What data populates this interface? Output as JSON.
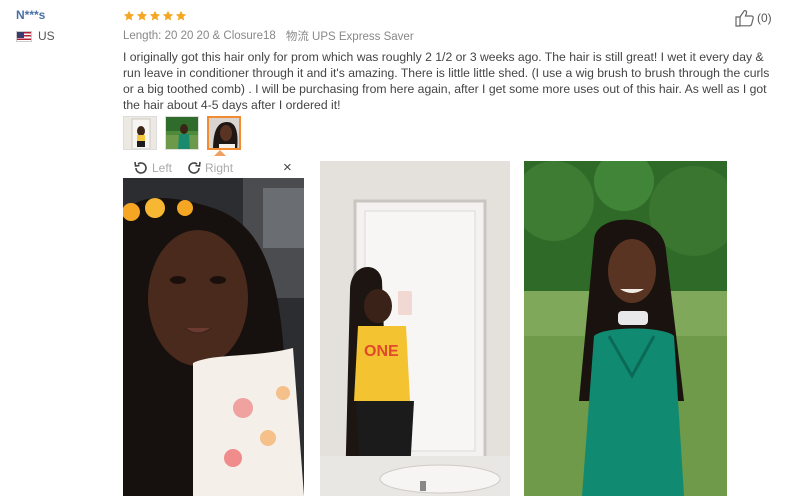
{
  "reviewer": {
    "name": "N***s",
    "country": "US"
  },
  "review": {
    "rating": 5,
    "star_color": "#f5a623",
    "length_label": "Length:",
    "length_value": "20 20 20 & Closure18",
    "shipping_label": "物流",
    "shipping_value": "UPS Express Saver",
    "text": "I originally got this hair only for prom which was roughly 2 1/2 or 3 weeks ago. The hair is still great! I wet it every day & run leave in conditioner through it and it's amazing. There is little little shed. (I use a wig brush to brush through the curls or a big toothed comb) . I will be purchasing from here again, after I get some more uses out of this hair. As well as I got the hair about 4-5 days after I ordered it!"
  },
  "helpful": {
    "icon": "thumbs-up-icon",
    "count": "(0)"
  },
  "viewer": {
    "rotate_left_label": "Left",
    "rotate_right_label": "Right",
    "close_label": "×",
    "active_thumb_color": "#f38b30"
  }
}
